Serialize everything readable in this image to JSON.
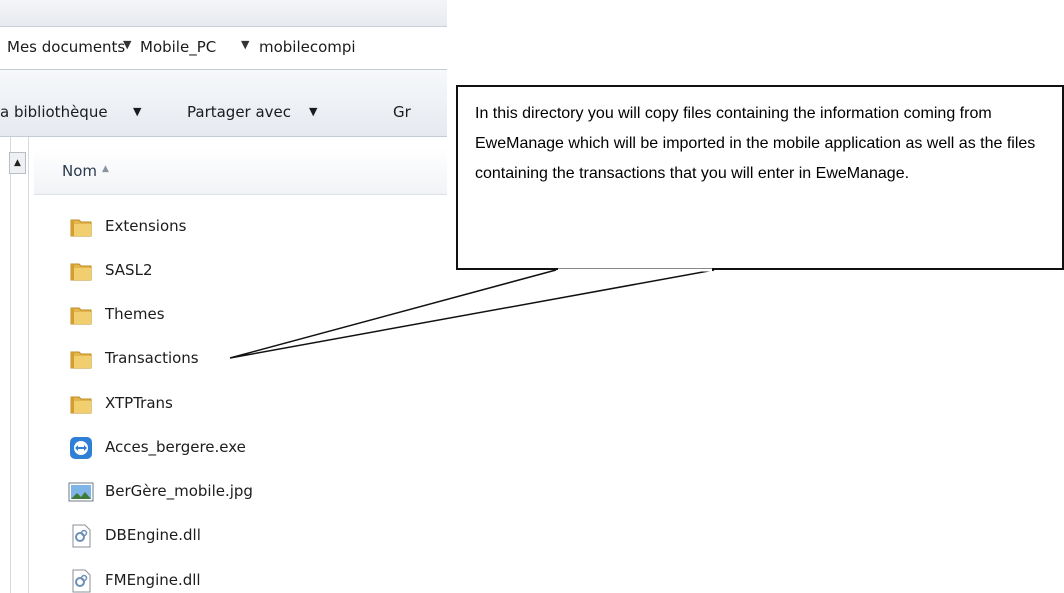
{
  "address_bar": {
    "crumbs": [
      "Mes documents",
      "Mobile_PC",
      "mobilecompi"
    ]
  },
  "toolbar": {
    "library_label": "a bibliothèque",
    "share_label": "Partager avec",
    "burn_label_partial": "Gr"
  },
  "column_header": {
    "name_label": "Nom",
    "sort_glyph": "^"
  },
  "files": [
    {
      "name": "Extensions",
      "type": "folder",
      "icon": "folder-icon"
    },
    {
      "name": "SASL2",
      "type": "folder",
      "icon": "folder-icon"
    },
    {
      "name": "Themes",
      "type": "folder",
      "icon": "folder-icon"
    },
    {
      "name": "Transactions",
      "type": "folder",
      "icon": "folder-icon"
    },
    {
      "name": "XTPTrans",
      "type": "folder",
      "icon": "folder-icon"
    },
    {
      "name": "Acces_bergere.exe",
      "type": "exe",
      "icon": "teamviewer-icon"
    },
    {
      "name": "BerGère_mobile.jpg",
      "type": "image",
      "icon": "image-file-icon"
    },
    {
      "name": "DBEngine.dll",
      "type": "dll",
      "icon": "dll-file-icon"
    },
    {
      "name": "FMEngine.dll",
      "type": "dll",
      "icon": "dll-file-icon"
    }
  ],
  "callout": {
    "text": "In this directory you will copy files containing the information coming from EweManage which will be imported in the mobile application as well as the files containing the transactions that you will enter in EweManage."
  },
  "colors": {
    "folder": "#e3b54a",
    "text": "#1c1c1c",
    "header_text": "#2b3a4f"
  }
}
